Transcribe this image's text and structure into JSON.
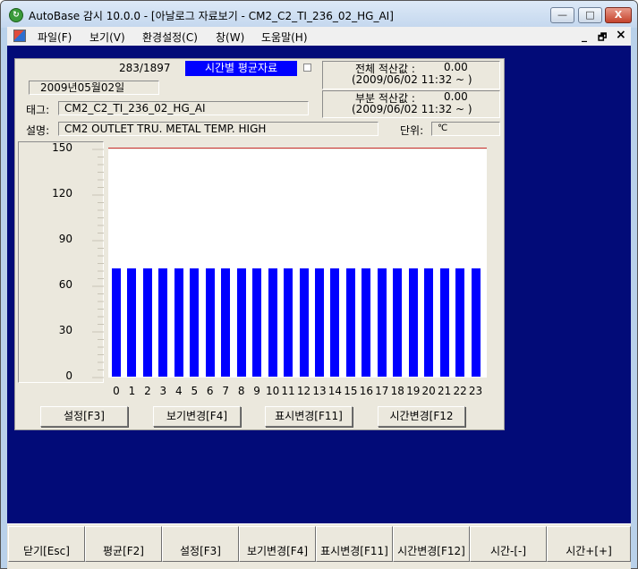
{
  "window": {
    "title": "AutoBase 감시 10.0.0 - [아날로그 자료보기 - CM2_C2_TI_236_02_HG_AI]",
    "min_symbol": "—",
    "max_symbol": "□",
    "close_symbol": "X"
  },
  "menu": {
    "items": [
      "파일(F)",
      "보기(V)",
      "환경설정(C)",
      "창(W)",
      "도움말(H)"
    ],
    "mdi_min": "_",
    "mdi_restore": "🗗",
    "mdi_close": "×"
  },
  "panel": {
    "record_count": "283/1897",
    "mode_label": "시간별 평균자료",
    "date": "2009년05월02일",
    "total_label": "전체 적산값 :",
    "total_value": "0.00",
    "total_since": "(2009/06/02 11:32 ~ )",
    "partial_label": "부분 적산값 :",
    "partial_value": "0.00",
    "partial_since": "(2009/06/02 11:32 ~ )",
    "tag_label": "태그:",
    "tag_value": "CM2_C2_TI_236_02_HG_AI",
    "desc_label": "설명:",
    "desc_value": "CM2 OUTLET TRU. METAL TEMP. HIGH",
    "unit_label": "단위:",
    "unit_value": "℃"
  },
  "chart_data": {
    "type": "bar",
    "categories": [
      "0",
      "1",
      "2",
      "3",
      "4",
      "5",
      "6",
      "7",
      "8",
      "9",
      "10",
      "11",
      "12",
      "13",
      "14",
      "15",
      "16",
      "17",
      "18",
      "19",
      "20",
      "21",
      "22",
      "23"
    ],
    "values": [
      71,
      71,
      71,
      71,
      71,
      71,
      71,
      71,
      71,
      71,
      71,
      71,
      71,
      71,
      71,
      71,
      71,
      71,
      71,
      71,
      71,
      71,
      71,
      71
    ],
    "y_ticks": [
      "150",
      "120",
      "90",
      "60",
      "30",
      "0"
    ],
    "ylim": [
      0,
      150
    ],
    "reference_line": 150,
    "bar_color": "#0000ff",
    "reference_color": "#cc3333"
  },
  "panel_buttons": [
    "설정[F3]",
    "보기변경[F4]",
    "표시변경[F11]",
    "시간변경[F12"
  ],
  "function_keys": [
    "닫기[Esc]",
    "평균[F2]",
    "설정[F3]",
    "보기변경[F4]",
    "표시변경[F11]",
    "시간변경[F12]",
    "시간-[-]",
    "시간+[+]"
  ],
  "colors": {
    "client_bg": "#020b78",
    "panel_bg": "#ebe8dd",
    "highlight": "#0000ff"
  }
}
